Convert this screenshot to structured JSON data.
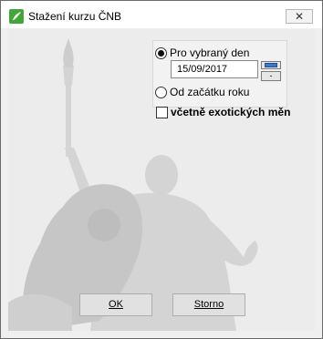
{
  "window": {
    "title": "Stažení kurzu ČNB",
    "close_glyph": "✕"
  },
  "options": {
    "radio_selected_day": "Pro vybraný den",
    "radio_selected_day_checked": true,
    "date_value": "15/09/2017",
    "calendar_minus_label": "-",
    "radio_year_start": "Od začátku roku",
    "radio_year_start_checked": false,
    "include_exotic_label": "včetně exotických měn",
    "include_exotic_checked": false
  },
  "buttons": {
    "ok": "OK",
    "cancel": "Storno"
  },
  "colors": {
    "accent_icon": "#44a63a",
    "calendar_button": "#3a78c8"
  },
  "icons": {
    "app": "cnb-app-icon",
    "close": "close-icon",
    "calendar": "calendar-icon"
  }
}
